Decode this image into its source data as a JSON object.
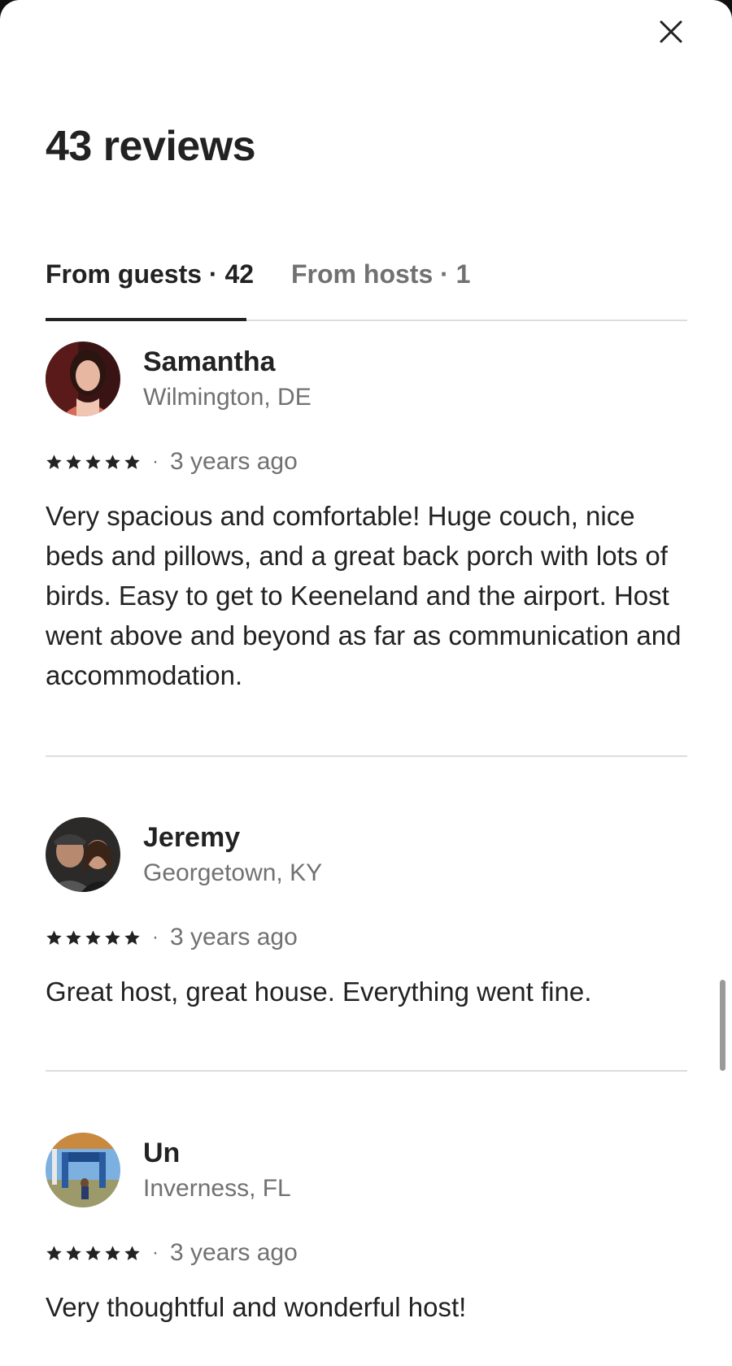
{
  "header": {
    "close_label": "close",
    "title": "43 reviews"
  },
  "tabs": [
    {
      "label": "From guests · 42",
      "active": true
    },
    {
      "label": "From hosts · 1",
      "active": false
    }
  ],
  "reviews": [
    {
      "name": "Samantha",
      "location": "Wilmington, DE",
      "rating": 5,
      "date": "3 years ago",
      "text": "Very spacious and comfortable! Huge couch, nice beds and pillows, and a great back porch with lots of birds. Easy to get to Keeneland and the airport. Host went above and beyond as far as communication and accommodation."
    },
    {
      "name": "Jeremy",
      "location": "Georgetown, KY",
      "rating": 5,
      "date": "3 years ago",
      "text": "Great host, great house. Everything went fine."
    },
    {
      "name": "Un",
      "location": "Inverness, FL",
      "rating": 5,
      "date": "3 years ago",
      "text": "Very thoughtful and wonderful host!"
    }
  ],
  "separator": "·",
  "colors": {
    "text_primary": "#222222",
    "text_secondary": "#717171",
    "divider": "#dddddd",
    "background": "#ffffff"
  }
}
